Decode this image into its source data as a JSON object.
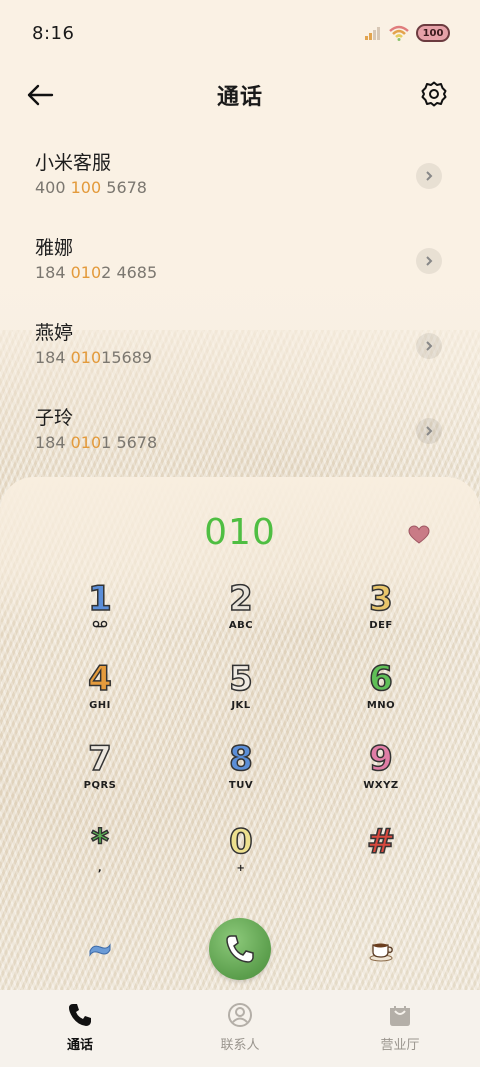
{
  "status": {
    "time": "8:16",
    "battery": "100"
  },
  "header": {
    "title": "通话"
  },
  "contacts": [
    {
      "name": "小米客服",
      "num_pre": "400 ",
      "num_hl": "100",
      "num_post": " 5678"
    },
    {
      "name": "雅娜",
      "num_pre": "184 ",
      "num_hl": "010",
      "num_post": "2 4685"
    },
    {
      "name": "燕婷",
      "num_pre": "184 ",
      "num_hl": "010",
      "num_post": "15689"
    },
    {
      "name": "子玲",
      "num_pre": "184 ",
      "num_hl": "010",
      "num_post": "1 5678"
    }
  ],
  "dial": {
    "input": "010"
  },
  "keys": [
    {
      "digit": "1",
      "letters": "",
      "color": "#5b8ed8"
    },
    {
      "digit": "2",
      "letters": "ABC",
      "color": "#e8e3da"
    },
    {
      "digit": "3",
      "letters": "DEF",
      "color": "#e9c66b"
    },
    {
      "digit": "4",
      "letters": "GHI",
      "color": "#e59b3c"
    },
    {
      "digit": "5",
      "letters": "JKL",
      "color": "#efeae2"
    },
    {
      "digit": "6",
      "letters": "MNO",
      "color": "#5fbf57"
    },
    {
      "digit": "7",
      "letters": "PQRS",
      "color": "#ece7df"
    },
    {
      "digit": "8",
      "letters": "TUV",
      "color": "#5b8ed8"
    },
    {
      "digit": "9",
      "letters": "WXYZ",
      "color": "#e07da6"
    },
    {
      "digit": "*",
      "letters": ",",
      "color": "#5fbf57"
    },
    {
      "digit": "0",
      "letters": "+",
      "color": "#ede08f"
    },
    {
      "digit": "#",
      "letters": "",
      "color": "#d9493e"
    }
  ],
  "tabs": [
    {
      "label": "通话",
      "icon": "phone-icon",
      "active": true
    },
    {
      "label": "联系人",
      "icon": "contacts-icon",
      "active": false
    },
    {
      "label": "营业厅",
      "icon": "store-bag-icon",
      "active": false
    }
  ],
  "colors": {
    "accent": "#4fbe42",
    "highlight": "#e39a3b"
  }
}
